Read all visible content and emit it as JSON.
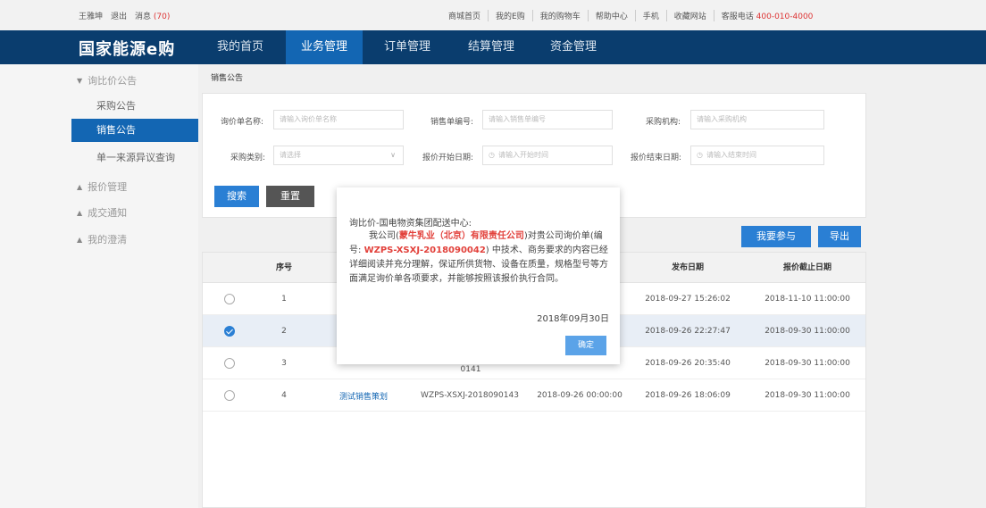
{
  "topbar": {
    "user": "王雅坤",
    "logout": "退出",
    "messages_label": "消息",
    "messages_count": "(70)",
    "links": [
      "商城首页",
      "我的E购",
      "我的购物车",
      "帮助中心",
      "手机",
      "收藏网站"
    ],
    "hotline_label": "客服电话",
    "hotline": "400-010-4000"
  },
  "nav": {
    "logo": "国家能源e购",
    "items": [
      "我的首页",
      "业务管理",
      "订单管理",
      "结算管理",
      "资金管理"
    ],
    "active_index": 1
  },
  "sidebar": {
    "groups": [
      "询比价公告",
      "报价管理",
      "成交通知",
      "我的澄清"
    ],
    "items": [
      "采购公告",
      "销售公告",
      "单一来源异议查询"
    ],
    "active_item": "销售公告"
  },
  "breadcrumb": "销售公告",
  "filters": {
    "inquiry_name_label": "询价单名称:",
    "inquiry_name_placeholder": "请输入询价单名称",
    "sales_no_label": "销售单编号:",
    "sales_no_placeholder": "请输入销售单编号",
    "org_label": "采购机构:",
    "org_placeholder": "请输入采购机构",
    "category_label": "采购类别:",
    "category_placeholder": "请选择",
    "start_label": "报价开始日期:",
    "start_placeholder": "请输入开始时间",
    "end_label": "报价结束日期:",
    "end_placeholder": "请输入结束时间"
  },
  "buttons": {
    "search": "搜索",
    "reset": "重置",
    "participate": "我要参与",
    "export": "导出"
  },
  "table": {
    "headers": [
      "序号",
      "发布日期",
      "报价截止日期"
    ],
    "rows": [
      {
        "no": "1",
        "name": "",
        "code": "",
        "start": "",
        "publish": "2018-09-27 15:26:02",
        "deadline": "2018-11-10 11:00:00",
        "selected": false
      },
      {
        "no": "2",
        "name": "",
        "code": "",
        "start": "",
        "publish": "2018-09-26 22:27:47",
        "deadline": "2018-09-30 11:00:00",
        "selected": true
      },
      {
        "no": "3",
        "name": "",
        "code": "0141",
        "start": "",
        "publish": "2018-09-26 20:35:40",
        "deadline": "2018-09-30 11:00:00",
        "selected": false
      },
      {
        "no": "4",
        "name": "测试销售策划",
        "code": "WZPS-XSXJ-2018090143",
        "start": "2018-09-26 00:00:00",
        "publish": "2018-09-26 18:06:09",
        "deadline": "2018-09-30 11:00:00",
        "selected": false
      }
    ]
  },
  "modal": {
    "from": "询比价-国电物资集团配送中心:",
    "company_pre": "我公司(",
    "company": "蒙牛乳业（北京）有限责任公司",
    "company_post": ")对贵公司询价单",
    "code_pre": "(编号:",
    "code": "WZPS-XSXJ-2018090042",
    "code_post": ") 中技术、商务要求的内容已经详细阅读并充分理解，保证所供货物、设备在质量，规格型号等方面满足询价单各项要求，并能够按照该报价执行合同。",
    "date": "2018年09月30日",
    "ok": "确定"
  },
  "colors": {
    "nav_bg": "#0a3d6e",
    "accent": "#1366b3",
    "highlight": "#e2413b"
  }
}
